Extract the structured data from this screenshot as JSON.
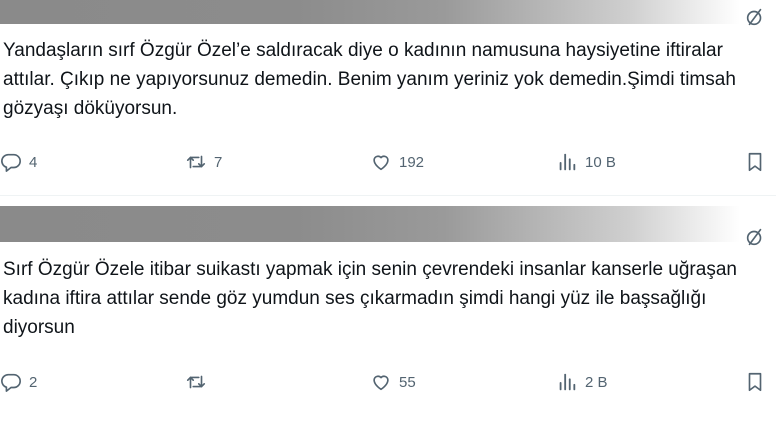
{
  "tweets": [
    {
      "text": "Yandaşların sırf Özgür Özel’e saldıracak diye o kadının namusuna haysiyetine iftiralar attılar. Çıkıp ne yapıyorsunuz demedin. Benim yanım yeriniz yok demedin.Şimdi timsah gözyaşı döküyorsun.",
      "reply_count": "4",
      "retweet_count": "7",
      "like_count": "192",
      "view_count": "10 B"
    },
    {
      "text": "Sırf Özgür Özele itibar suikastı yapmak için senin çevrendeki insanlar kanserle uğraşan kadına iftira attılar sende göz yumdun ses çıkarmadın şimdi hangi yüz ile başsağlığı diyorsun",
      "reply_count": "2",
      "retweet_count": "",
      "like_count": "55",
      "view_count": "2 B"
    }
  ],
  "icons": {
    "menu": "grok-slash-circle-icon",
    "reply": "reply-icon",
    "retweet": "retweet-icon",
    "like": "heart-icon",
    "views": "views-bar-chart-icon",
    "bookmark": "bookmark-icon"
  },
  "colors": {
    "text": "#0f1419",
    "secondary": "#536471",
    "redaction": "#8c8c8c"
  }
}
